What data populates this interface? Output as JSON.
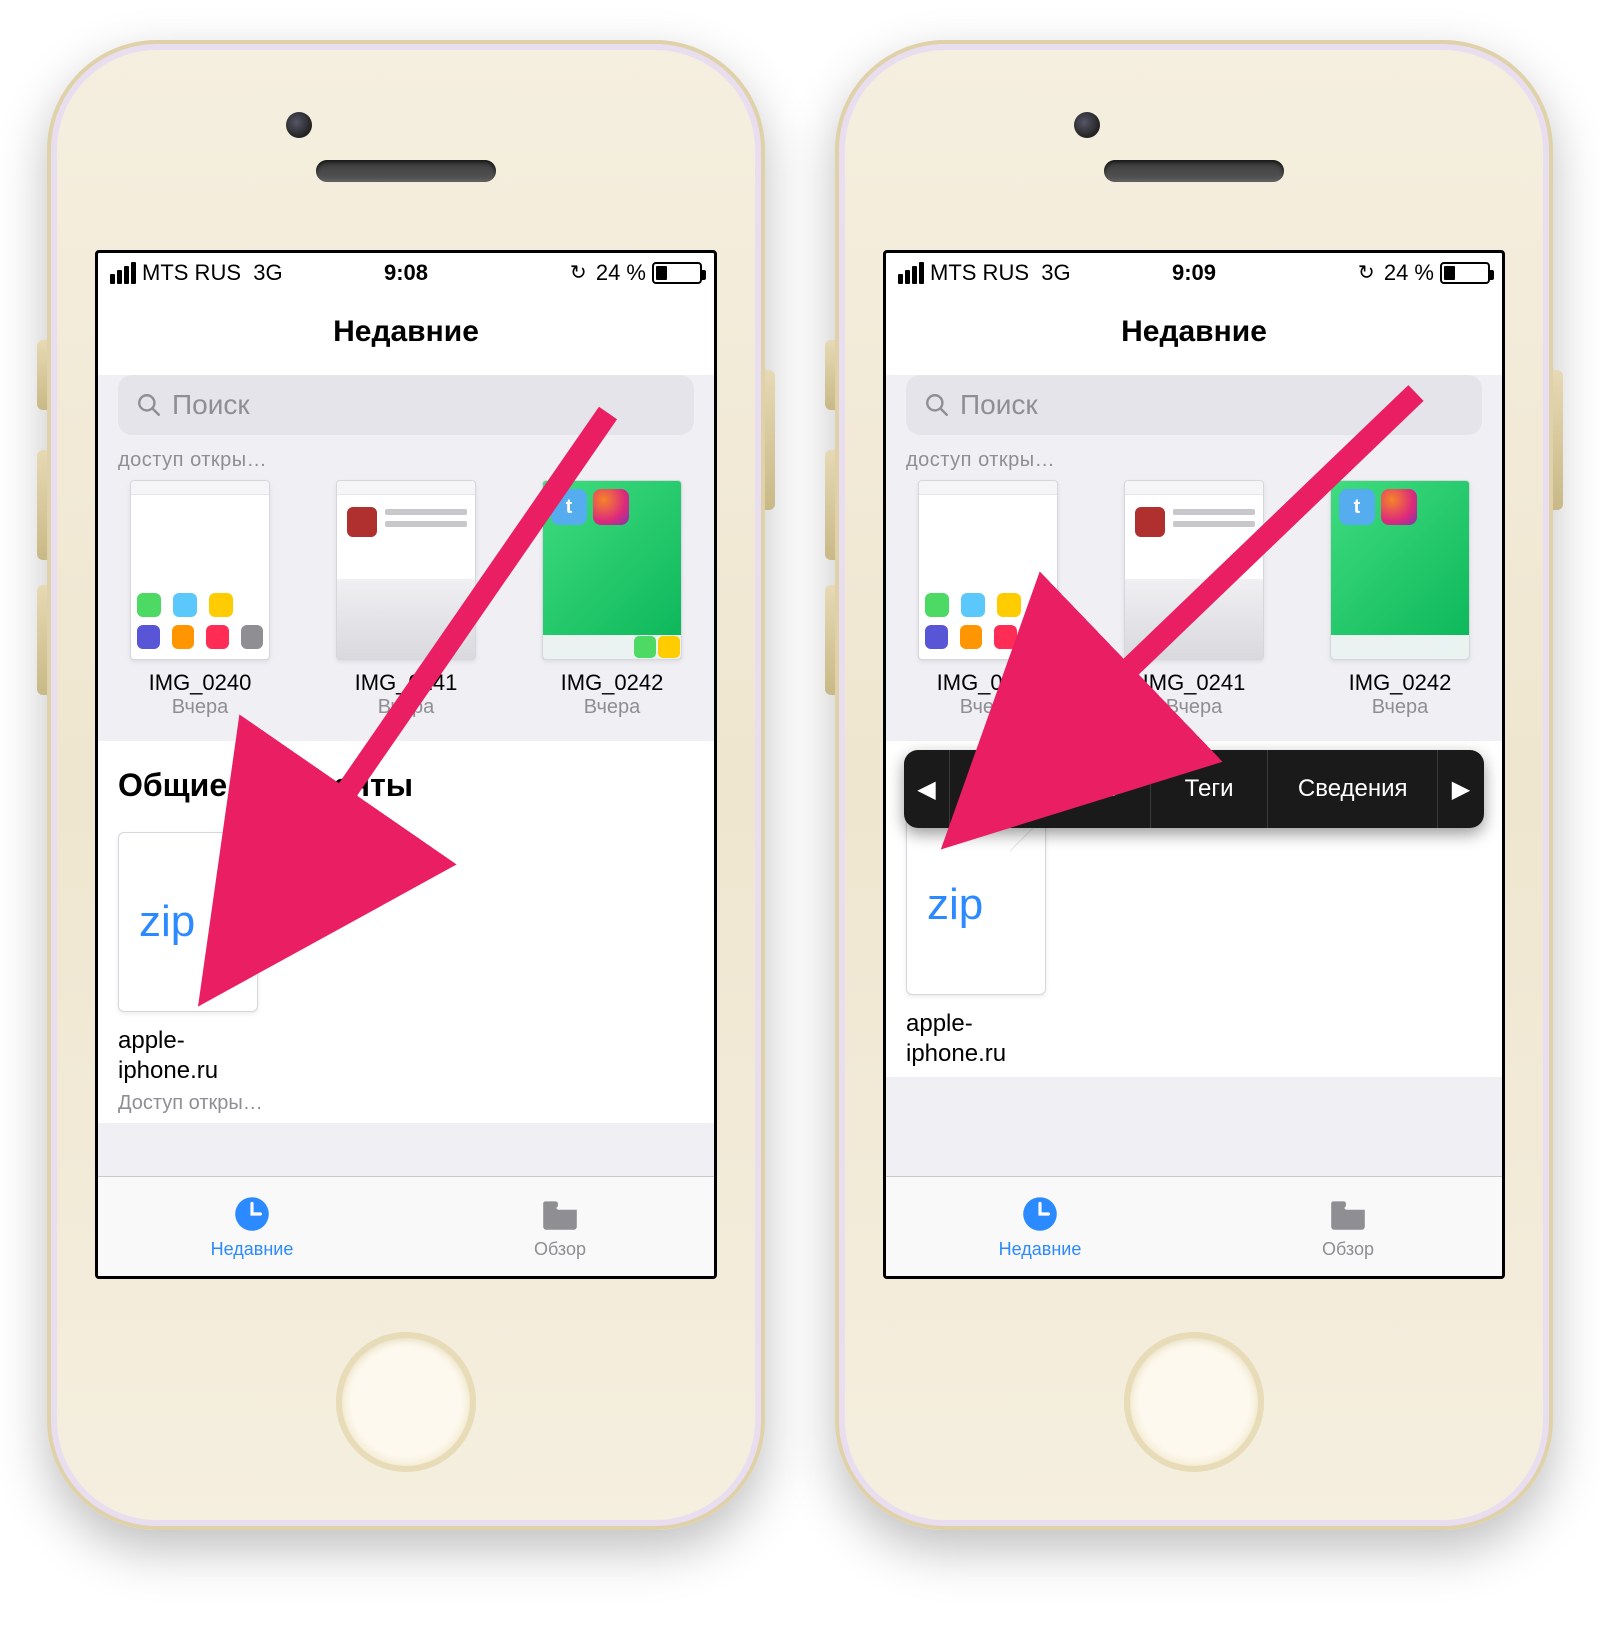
{
  "phones": [
    {
      "status": {
        "carrier": "MTS RUS",
        "net": "3G",
        "time": "9:08",
        "battery_pct": "24 %"
      },
      "title": "Недавние",
      "search": {
        "placeholder": "Поиск"
      },
      "section_label": "доступ откры…",
      "thumbs": [
        {
          "name": "IMG_0240",
          "date": "Вчера"
        },
        {
          "name": "IMG_0241",
          "date": "Вчера"
        },
        {
          "name": "IMG_0242",
          "date": "Вчера"
        }
      ],
      "panel_title": "Общие документы",
      "file": {
        "ext": "zip",
        "name_line1": "apple-",
        "name_line2": "iphone.ru",
        "sub": "Доступ откры…"
      },
      "tabs": {
        "recent": "Недавние",
        "browse": "Обзор"
      },
      "has_popover": false
    },
    {
      "status": {
        "carrier": "MTS RUS",
        "net": "3G",
        "time": "9:09",
        "battery_pct": "24 %"
      },
      "title": "Недавние",
      "search": {
        "placeholder": "Поиск"
      },
      "section_label": "доступ откры…",
      "thumbs": [
        {
          "name": "IMG_0240",
          "date": "Вчера"
        },
        {
          "name": "IMG_0241",
          "date": "Вчера"
        },
        {
          "name": "IMG_0242",
          "date": "Вчера"
        }
      ],
      "panel_title": "",
      "file": {
        "ext": "zip",
        "name_line1": "apple-",
        "name_line2": "iphone.ru",
        "sub": ""
      },
      "tabs": {
        "recent": "Недавние",
        "browse": "Обзор"
      },
      "has_popover": true,
      "popover": {
        "prev": "◀",
        "share": "Поделиться",
        "tags": "Теги",
        "info": "Сведения",
        "next": "▶"
      }
    }
  ]
}
